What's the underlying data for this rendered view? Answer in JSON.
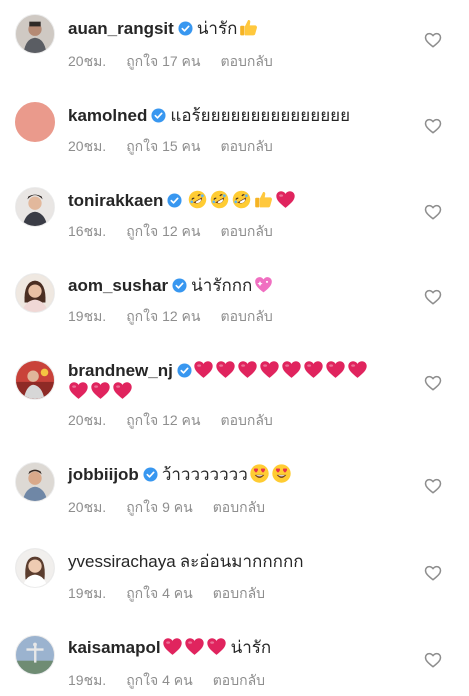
{
  "comments": [
    {
      "username": "auan_rangsit",
      "verified": true,
      "text": "น่ารัก",
      "emojis": [
        "thumbs-up-emoji"
      ],
      "time": "20ชม.",
      "likes": "ถูกใจ 17 คน",
      "reply": "ตอบกลับ"
    },
    {
      "username": "kamolned",
      "verified": true,
      "text": "แอร้ยยยยยยยยยยยยยยย",
      "emojis": [],
      "time": "20ชม.",
      "likes": "ถูกใจ 15 คน",
      "reply": "ตอบกลับ"
    },
    {
      "username": "tonirakkaen",
      "verified": true,
      "text": "",
      "emojis": [
        "rofl-emoji",
        "rofl-emoji",
        "rofl-emoji",
        "thumbs-up-emoji",
        "red-heart-emoji"
      ],
      "time": "16ชม.",
      "likes": "ถูกใจ 12 คน",
      "reply": "ตอบกลับ"
    },
    {
      "username": "aom_sushar",
      "verified": true,
      "text": "น่ารักกก",
      "emojis": [
        "sparkling-heart-emoji"
      ],
      "time": "19ชม.",
      "likes": "ถูกใจ 12 คน",
      "reply": "ตอบกลับ"
    },
    {
      "username": "brandnew_nj",
      "verified": true,
      "text": "",
      "emojis": [
        "red-heart-emoji",
        "red-heart-emoji",
        "red-heart-emoji",
        "red-heart-emoji",
        "red-heart-emoji",
        "red-heart-emoji",
        "red-heart-emoji",
        "red-heart-emoji",
        "red-heart-emoji",
        "red-heart-emoji",
        "red-heart-emoji"
      ],
      "time": "20ชม.",
      "likes": "ถูกใจ 12 คน",
      "reply": "ตอบกลับ"
    },
    {
      "username": "jobbiijob",
      "verified": true,
      "text": "ว้าววววววว",
      "emojis": [
        "heart-eyes-emoji",
        "heart-eyes-emoji"
      ],
      "time": "20ชม.",
      "likes": "ถูกใจ 9 คน",
      "reply": "ตอบกลับ"
    },
    {
      "username": "yvessirachaya",
      "verified": false,
      "text": "ละอ่อนมากกกกก",
      "emojis": [],
      "time": "19ชม.",
      "likes": "ถูกใจ 4 คน",
      "reply": "ตอบกลับ"
    },
    {
      "username": "kaisamapol",
      "verified": false,
      "text": "น่ารัก",
      "emojis": [
        "red-heart-emoji",
        "red-heart-emoji",
        "red-heart-emoji"
      ],
      "time": "19ชม.",
      "likes": "ถูกใจ 4 คน",
      "reply": "ตอบกลับ"
    }
  ],
  "colors": {
    "text": "#262626",
    "meta": "#8e8e8e",
    "verified": "#3897f0",
    "heart_outline": "#8e8e8e",
    "red_heart": "#e0245e",
    "kamolned_avatar": "#ea9a8c"
  }
}
